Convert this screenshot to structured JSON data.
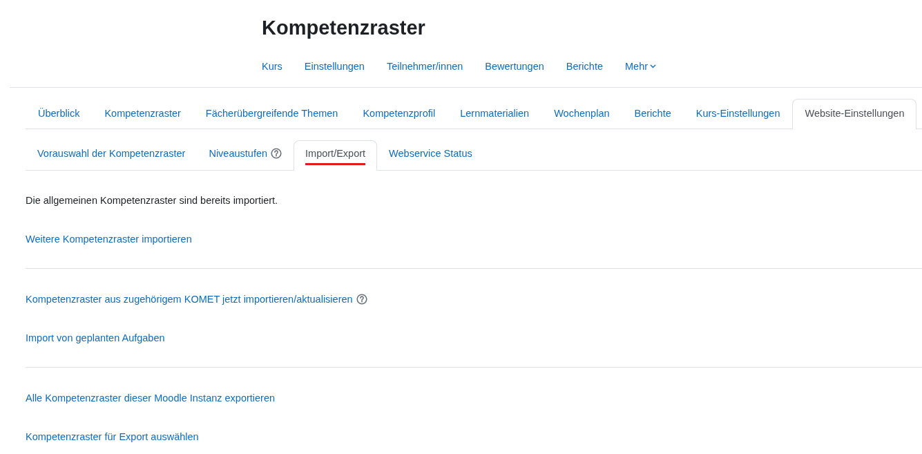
{
  "page_title": "Kompetenzraster",
  "course_nav": [
    {
      "label": "Kurs",
      "dropdown": false
    },
    {
      "label": "Einstellungen",
      "dropdown": false
    },
    {
      "label": "Teilnehmer/innen",
      "dropdown": false
    },
    {
      "label": "Bewertungen",
      "dropdown": false
    },
    {
      "label": "Berichte",
      "dropdown": false
    },
    {
      "label": "Mehr",
      "dropdown": true
    }
  ],
  "tabs": [
    {
      "label": "Überblick",
      "selected": false
    },
    {
      "label": "Kompetenzraster",
      "selected": false
    },
    {
      "label": "Fächerübergreifende Themen",
      "selected": false
    },
    {
      "label": "Kompetenzprofil",
      "selected": false
    },
    {
      "label": "Lernmaterialien",
      "selected": false
    },
    {
      "label": "Wochenplan",
      "selected": false
    },
    {
      "label": "Berichte",
      "selected": false
    },
    {
      "label": "Kurs-Einstellungen",
      "selected": false
    },
    {
      "label": "Website-Einstellungen",
      "selected": true
    }
  ],
  "subtabs": [
    {
      "label": "Vorauswahl der Kompetenzraster",
      "selected": false,
      "help": false
    },
    {
      "label": "Niveaustufen",
      "selected": false,
      "help": true
    },
    {
      "label": "Import/Export",
      "selected": true,
      "help": false
    },
    {
      "label": "Webservice Status",
      "selected": false,
      "help": false
    }
  ],
  "sections": [
    {
      "items": [
        {
          "kind": "text",
          "text": "Die allgemeinen Kompetenzraster sind bereits importiert.",
          "help": false
        },
        {
          "kind": "link",
          "text": "Weitere Kompetenzraster importieren",
          "help": false
        }
      ]
    },
    {
      "items": [
        {
          "kind": "link",
          "text": "Kompetenzraster aus zugehörigem KOMET jetzt importieren/aktualisieren",
          "help": true
        },
        {
          "kind": "link",
          "text": "Import von geplanten Aufgaben",
          "help": false
        }
      ]
    },
    {
      "items": [
        {
          "kind": "link",
          "text": "Alle Kompetenzraster dieser Moodle Instanz exportieren",
          "help": false
        },
        {
          "kind": "link",
          "text": "Kompetenzraster für Export auswählen",
          "help": false
        }
      ]
    }
  ]
}
